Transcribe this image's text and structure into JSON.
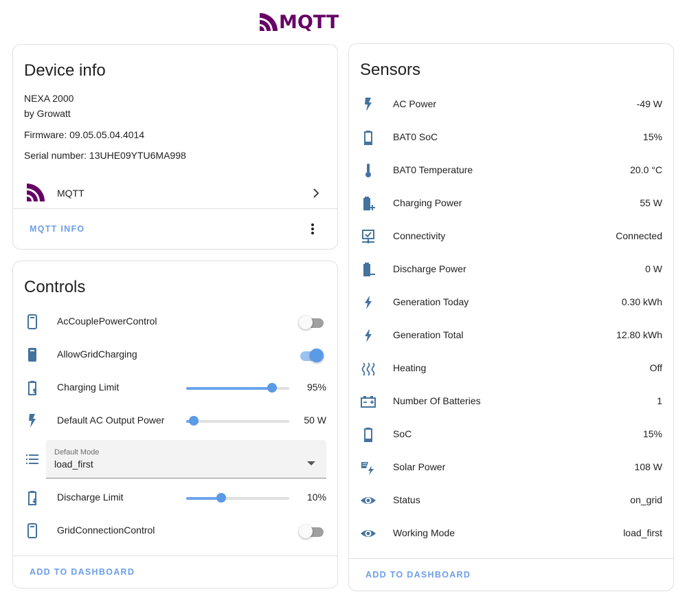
{
  "logo": {
    "text": "MQTT"
  },
  "device_info": {
    "title": "Device info",
    "model": "NEXA 2000",
    "manufacturer": "by Growatt",
    "firmware": "Firmware: 09.05.05.04.4014",
    "serial": "Serial number: 13UHE09YTU6MA998",
    "integration_label": "MQTT",
    "integration_icon": "mqtt-icon",
    "action_label": "MQTT INFO"
  },
  "controls": {
    "title": "Controls",
    "items": [
      {
        "name": "AcCouplePowerControl",
        "icon": "phone-outline-icon",
        "type": "toggle",
        "state": "off"
      },
      {
        "name": "AllowGridCharging",
        "icon": "phone-solid-icon",
        "type": "toggle",
        "state": "on"
      },
      {
        "name": "Charging Limit",
        "icon": "battery-charging-icon",
        "type": "slider",
        "value_text": "95%",
        "level": 0.83
      },
      {
        "name": "Default AC Output Power",
        "icon": "flash-icon",
        "type": "slider",
        "value_text": "50 W",
        "level": 0.07
      },
      {
        "name": "Discharge Limit",
        "icon": "battery-discharging-icon",
        "type": "slider",
        "value_text": "10%",
        "level": 0.34
      },
      {
        "name": "GridConnectionControl",
        "icon": "phone-outline-icon",
        "type": "toggle",
        "state": "off"
      }
    ],
    "select": {
      "icon": "list-icon",
      "label": "Default Mode",
      "value": "load_first"
    },
    "action_label": "ADD TO DASHBOARD"
  },
  "sensors": {
    "title": "Sensors",
    "items": [
      {
        "name": "AC Power",
        "value": "-49 W",
        "icon": "flash-icon"
      },
      {
        "name": "BAT0 SoC",
        "value": "15%",
        "icon": "battery-icon"
      },
      {
        "name": "BAT0 Temperature",
        "value": "20.0 °C",
        "icon": "thermometer-icon"
      },
      {
        "name": "Charging Power",
        "value": "55 W",
        "icon": "battery-plus-icon"
      },
      {
        "name": "Connectivity",
        "value": "Connected",
        "icon": "connectivity-icon"
      },
      {
        "name": "Discharge Power",
        "value": "0 W",
        "icon": "battery-minus-icon"
      },
      {
        "name": "Generation Today",
        "value": "0.30 kWh",
        "icon": "lightning-icon"
      },
      {
        "name": "Generation Total",
        "value": "12.80 kWh",
        "icon": "lightning-icon"
      },
      {
        "name": "Heating",
        "value": "Off",
        "icon": "heat-waves-icon"
      },
      {
        "name": "Number Of Batteries",
        "value": "1",
        "icon": "car-battery-icon"
      },
      {
        "name": "SoC",
        "value": "15%",
        "icon": "battery-icon"
      },
      {
        "name": "Solar Power",
        "value": "108 W",
        "icon": "solar-power-icon"
      },
      {
        "name": "Status",
        "value": "on_grid",
        "icon": "eye-icon"
      },
      {
        "name": "Working Mode",
        "value": "load_first",
        "icon": "eye-icon"
      }
    ],
    "action_label": "ADD TO DASHBOARD"
  },
  "colors": {
    "icon": "#44739e",
    "accent": "#5a9ae6",
    "brand": "#660066",
    "link": "#6c9ee8"
  }
}
